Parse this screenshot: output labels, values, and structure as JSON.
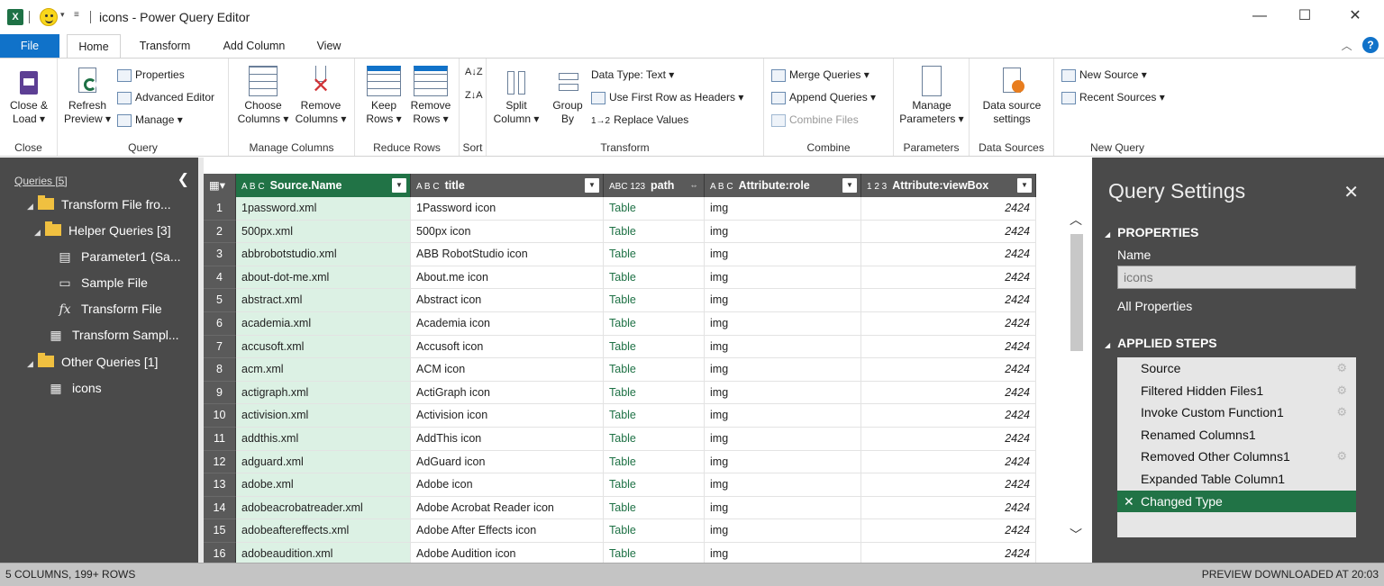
{
  "window": {
    "title": "icons - Power Query Editor",
    "minimize": "—",
    "maximize": "☐",
    "close": "✕"
  },
  "tabs": [
    {
      "label": "File"
    },
    {
      "label": "Home"
    },
    {
      "label": "Transform"
    },
    {
      "label": "Add Column"
    },
    {
      "label": "View"
    }
  ],
  "ribbon": {
    "close_group": {
      "label": "Close",
      "close_load": "Close &",
      "close_load2": "Load ▾"
    },
    "query_group": {
      "label": "Query",
      "refresh": "Refresh",
      "refresh2": "Preview ▾",
      "properties": "Properties",
      "advanced_editor": "Advanced Editor",
      "manage": "Manage ▾"
    },
    "manage_columns_group": {
      "label": "Manage Columns",
      "choose": "Choose",
      "choose2": "Columns ▾",
      "remove": "Remove",
      "remove2": "Columns ▾"
    },
    "reduce_rows_group": {
      "label": "Reduce Rows",
      "keep": "Keep",
      "keep2": "Rows ▾",
      "remove": "Remove",
      "remove2": "Rows ▾"
    },
    "sort_group": {
      "label": "Sort"
    },
    "transform_group": {
      "label": "Transform",
      "split": "Split",
      "split2": "Column ▾",
      "group": "Group",
      "group2": "By",
      "data_type": "Data Type: Text ▾",
      "first_row": "Use First Row as Headers ▾",
      "replace": "Replace Values"
    },
    "combine_group": {
      "label": "Combine",
      "merge": "Merge Queries ▾",
      "append": "Append Queries ▾",
      "combine_files": "Combine Files"
    },
    "parameters_group": {
      "label": "Parameters",
      "manage": "Manage",
      "manage2": "Parameters ▾"
    },
    "data_sources_group": {
      "label": "Data Sources",
      "settings": "Data source",
      "settings2": "settings"
    },
    "new_query_group": {
      "label": "New Query",
      "new_source": "New Source ▾",
      "recent_sources": "Recent Sources ▾"
    }
  },
  "queries_pane": {
    "header": "Queries [5]",
    "items": [
      {
        "label": "Transform File fro..."
      },
      {
        "label": "Helper Queries [3]"
      },
      {
        "label": "Parameter1 (Sa..."
      },
      {
        "label": "Sample File"
      },
      {
        "label": "Transform File"
      },
      {
        "label": "Transform Sampl..."
      },
      {
        "label": "Other Queries [1]"
      },
      {
        "label": "icons"
      }
    ]
  },
  "grid": {
    "columns": [
      {
        "type": "A B C",
        "name": "Source.Name"
      },
      {
        "type": "A B C",
        "name": "title"
      },
      {
        "type": "ABC 123",
        "name": "path"
      },
      {
        "type": "A B C",
        "name": "Attribute:role"
      },
      {
        "type": "1 2 3",
        "name": "Attribute:viewBox"
      }
    ],
    "rows": [
      {
        "n": "1",
        "source": "1password.xml",
        "title": "1Password icon",
        "path": "Table",
        "role": "img",
        "viewbox": "2424"
      },
      {
        "n": "2",
        "source": "500px.xml",
        "title": "500px icon",
        "path": "Table",
        "role": "img",
        "viewbox": "2424"
      },
      {
        "n": "3",
        "source": "abbrobotstudio.xml",
        "title": "ABB RobotStudio icon",
        "path": "Table",
        "role": "img",
        "viewbox": "2424"
      },
      {
        "n": "4",
        "source": "about-dot-me.xml",
        "title": "About.me icon",
        "path": "Table",
        "role": "img",
        "viewbox": "2424"
      },
      {
        "n": "5",
        "source": "abstract.xml",
        "title": "Abstract icon",
        "path": "Table",
        "role": "img",
        "viewbox": "2424"
      },
      {
        "n": "6",
        "source": "academia.xml",
        "title": "Academia icon",
        "path": "Table",
        "role": "img",
        "viewbox": "2424"
      },
      {
        "n": "7",
        "source": "accusoft.xml",
        "title": "Accusoft icon",
        "path": "Table",
        "role": "img",
        "viewbox": "2424"
      },
      {
        "n": "8",
        "source": "acm.xml",
        "title": "ACM icon",
        "path": "Table",
        "role": "img",
        "viewbox": "2424"
      },
      {
        "n": "9",
        "source": "actigraph.xml",
        "title": "ActiGraph icon",
        "path": "Table",
        "role": "img",
        "viewbox": "2424"
      },
      {
        "n": "10",
        "source": "activision.xml",
        "title": "Activision icon",
        "path": "Table",
        "role": "img",
        "viewbox": "2424"
      },
      {
        "n": "11",
        "source": "addthis.xml",
        "title": "AddThis icon",
        "path": "Table",
        "role": "img",
        "viewbox": "2424"
      },
      {
        "n": "12",
        "source": "adguard.xml",
        "title": "AdGuard icon",
        "path": "Table",
        "role": "img",
        "viewbox": "2424"
      },
      {
        "n": "13",
        "source": "adobe.xml",
        "title": "Adobe icon",
        "path": "Table",
        "role": "img",
        "viewbox": "2424"
      },
      {
        "n": "14",
        "source": "adobeacrobatreader.xml",
        "title": "Adobe Acrobat Reader icon",
        "path": "Table",
        "role": "img",
        "viewbox": "2424"
      },
      {
        "n": "15",
        "source": "adobeaftereffects.xml",
        "title": "Adobe After Effects icon",
        "path": "Table",
        "role": "img",
        "viewbox": "2424"
      },
      {
        "n": "16",
        "source": "adobeaudition.xml",
        "title": "Adobe Audition icon",
        "path": "Table",
        "role": "img",
        "viewbox": "2424"
      }
    ]
  },
  "settings_pane": {
    "title": "Query Settings",
    "close": "✕",
    "properties_header": "PROPERTIES",
    "name_label": "Name",
    "name_value": "icons",
    "all_properties": "All Properties",
    "applied_steps_header": "APPLIED STEPS",
    "steps": [
      {
        "label": "Source"
      },
      {
        "label": "Filtered Hidden Files1"
      },
      {
        "label": "Invoke Custom Function1"
      },
      {
        "label": "Renamed Columns1"
      },
      {
        "label": "Removed Other Columns1"
      },
      {
        "label": "Expanded Table Column1"
      },
      {
        "label": "Changed Type"
      }
    ]
  },
  "status_bar": {
    "left": "5 COLUMNS, 199+ ROWS",
    "right": "PREVIEW DOWNLOADED AT 20:03"
  },
  "colors": {
    "accent_blue": "#1072c9",
    "selected_green": "#217346",
    "pane_dark": "#4a4a4a",
    "column_highlight": "#dcf1e4"
  }
}
